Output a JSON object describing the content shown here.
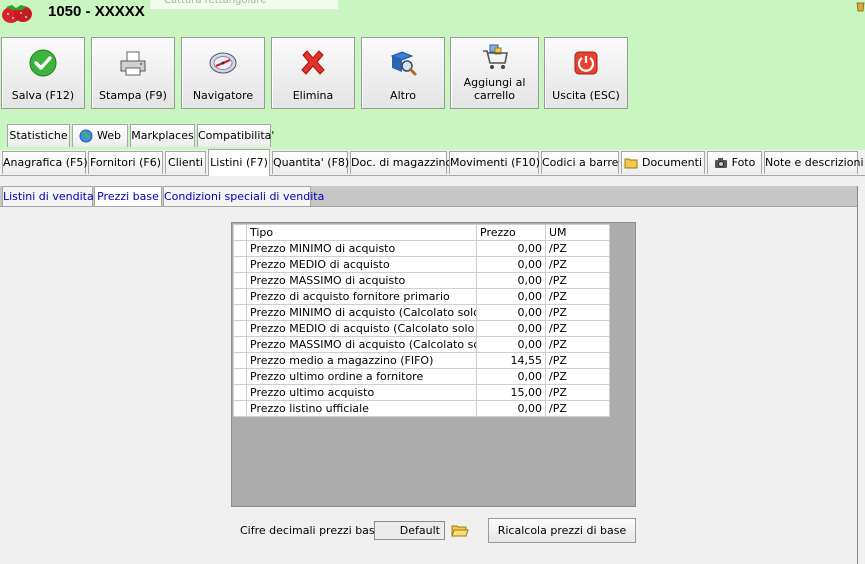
{
  "window": {
    "title": "1050 - XXXXX",
    "ghost_tooltip": "Cattura rettangolare"
  },
  "toolbar": {
    "buttons": [
      {
        "label": "Salva (F12)",
        "icon": "check-icon"
      },
      {
        "label": "Stampa (F9)",
        "icon": "printer-icon"
      },
      {
        "label": "Navigatore",
        "icon": "compass-icon"
      },
      {
        "label": "Elimina",
        "icon": "delete-x-icon"
      },
      {
        "label": "Altro",
        "icon": "book-search-icon"
      },
      {
        "label": "Aggiungi al carrello",
        "label_line1": "Aggiungi al",
        "label_line2": "carrello",
        "icon": "cart-icon"
      },
      {
        "label": "Uscita (ESC)",
        "icon": "power-icon"
      }
    ]
  },
  "tabs_row1": [
    "Statistiche",
    "Web",
    "Markplaces",
    "Compatibilita'"
  ],
  "tabs_row2": [
    "Anagrafica (F5)",
    "Fornitori (F6)",
    "Clienti",
    "Listini (F7)",
    "Quantita' (F8)",
    "Doc. di magazzino",
    "Movimenti (F10)",
    "Codici a barre",
    "Documenti",
    "Foto",
    "Note e descrizioni"
  ],
  "active_tab": "Listini (F7)",
  "subtabs": [
    "Listini di vendita",
    "Prezzi base",
    "Condizioni speciali di vendita"
  ],
  "active_subtab": "Prezzi base",
  "grid": {
    "columns": [
      "Tipo",
      "Prezzo",
      "UM"
    ],
    "rows": [
      [
        "Prezzo MINIMO di acquisto",
        "0,00",
        "/PZ"
      ],
      [
        "Prezzo MEDIO di acquisto",
        "0,00",
        "/PZ"
      ],
      [
        "Prezzo MASSIMO di acquisto",
        "0,00",
        "/PZ"
      ],
      [
        "Prezzo di acquisto fornitore primario",
        "0,00",
        "/PZ"
      ],
      [
        "Prezzo MINIMO di acquisto (Calcolato solo su fo",
        "0,00",
        "/PZ"
      ],
      [
        "Prezzo MEDIO di acquisto (Calcolato solo su for",
        "0,00",
        "/PZ"
      ],
      [
        "Prezzo MASSIMO di acquisto (Calcolato solo su",
        "0,00",
        "/PZ"
      ],
      [
        "Prezzo medio a magazzino (FIFO)",
        "14,55",
        "/PZ"
      ],
      [
        "Prezzo ultimo ordine a fornitore",
        "0,00",
        "/PZ"
      ],
      [
        "Prezzo ultimo acquisto",
        "15,00",
        "/PZ"
      ],
      [
        "Prezzo listino ufficiale",
        "0,00",
        "/PZ"
      ]
    ]
  },
  "footer": {
    "decimals_label": "Cifre decimali prezzi base :",
    "decimals_value": "Default",
    "recalc_button": "Ricalcola prezzi di base"
  },
  "colors": {
    "toolbar_bg": "#c8f5c0",
    "link_blue": "#0000b8",
    "grid_empty_bg": "#acacac"
  }
}
